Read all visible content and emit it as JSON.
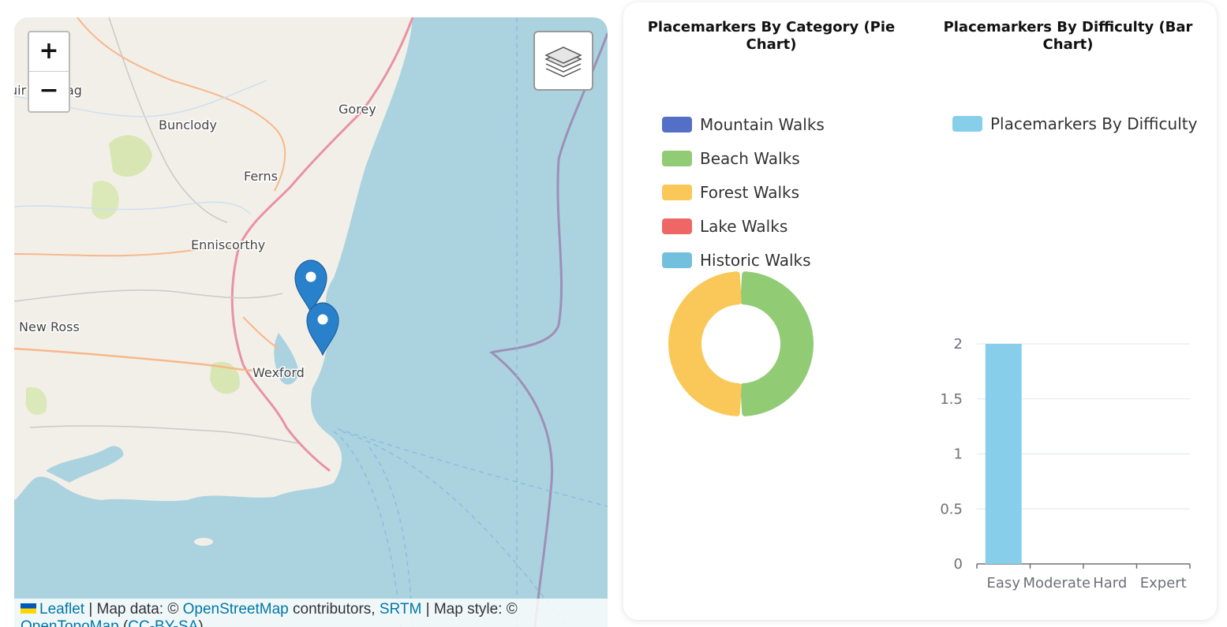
{
  "map": {
    "places": [
      "Gorey",
      "Bunclody",
      "Ferns",
      "Enniscorthy",
      "New Ross",
      "Wexford"
    ],
    "partial_places": [
      "uir",
      "ag"
    ],
    "zoom_in_label": "+",
    "zoom_out_label": "−",
    "layers_icon": "layers-icon",
    "marker_icon": "map-marker-icon",
    "attribution": {
      "leaflet": "Leaflet",
      "text1": " | Map data: © ",
      "osm": "OpenStreetMap",
      "text2": " contributors, ",
      "srtm": "SRTM",
      "text3": " | Map style: © ",
      "opentopomap": "OpenTopoMap",
      "text4": " (",
      "ccbysa": "CC-BY-SA",
      "text5": ")"
    },
    "colors": {
      "sea": "#aad3df",
      "land": "#f2efe9",
      "marker": "#2a81cb"
    }
  },
  "pie_chart": {
    "title": "Placemarkers By Category (Pie Chart)",
    "legend": [
      {
        "label": "Mountain Walks",
        "color": "#5470c6"
      },
      {
        "label": "Beach Walks",
        "color": "#91cc75"
      },
      {
        "label": "Forest Walks",
        "color": "#fac858"
      },
      {
        "label": "Lake Walks",
        "color": "#ee6666"
      },
      {
        "label": "Historic Walks",
        "color": "#73c0de"
      }
    ]
  },
  "bar_chart": {
    "title": "Placemarkers By Difficulty (Bar Chart)",
    "legend_label": "Placemarkers By Difficulty",
    "color": "#87ceeb"
  },
  "chart_data": [
    {
      "type": "pie",
      "title": "Placemarkers By Category (Pie Chart)",
      "categories": [
        "Mountain Walks",
        "Beach Walks",
        "Forest Walks",
        "Lake Walks",
        "Historic Walks"
      ],
      "values": [
        0,
        1,
        1,
        0,
        0
      ],
      "colors": [
        "#5470c6",
        "#91cc75",
        "#fac858",
        "#ee6666",
        "#73c0de"
      ],
      "legend": "top"
    },
    {
      "type": "bar",
      "title": "Placemarkers By Difficulty (Bar Chart)",
      "categories": [
        "Easy",
        "Moderate",
        "Hard",
        "Expert"
      ],
      "series": [
        {
          "name": "Placemarkers By Difficulty",
          "values": [
            2,
            0,
            0,
            0
          ]
        }
      ],
      "yticks": [
        "0",
        "0.5",
        "1",
        "1.5",
        "2"
      ],
      "ylim": [
        0,
        2
      ],
      "grid": true,
      "legend": "top"
    }
  ]
}
